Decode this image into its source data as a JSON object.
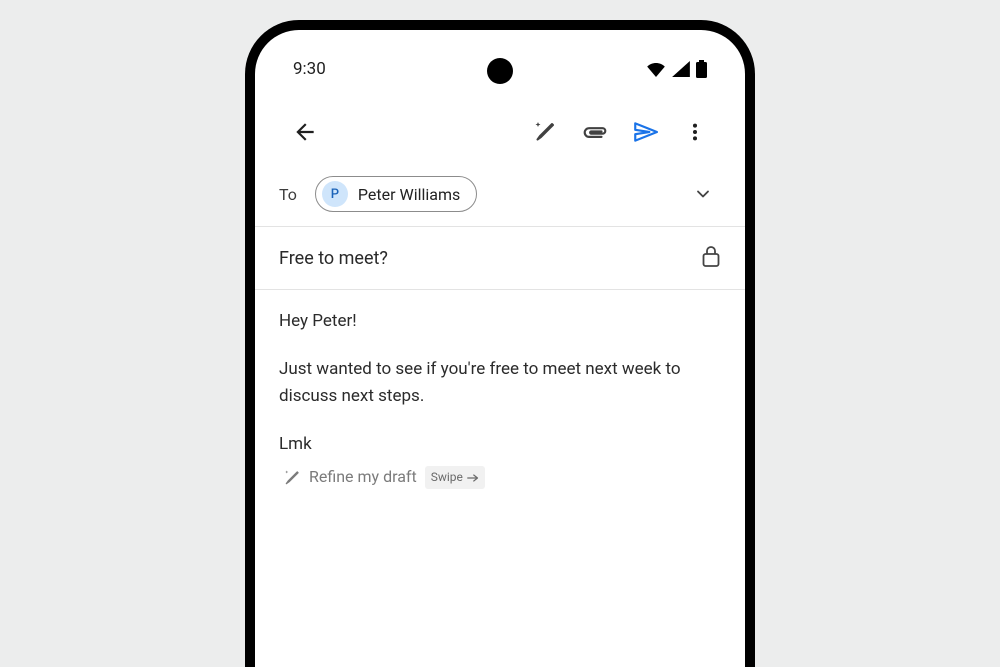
{
  "status": {
    "time": "9:30"
  },
  "compose": {
    "to_label": "To",
    "recipient_initial": "P",
    "recipient_name": "Peter Williams",
    "subject": "Free to meet?",
    "body_line1": "Hey Peter!",
    "body_line2": "Just wanted to see if you're free to meet next week to discuss next steps.",
    "body_line3": "Lmk"
  },
  "refine": {
    "label": "Refine my draft",
    "badge": "Swipe"
  },
  "colors": {
    "send": "#1a73e8"
  }
}
